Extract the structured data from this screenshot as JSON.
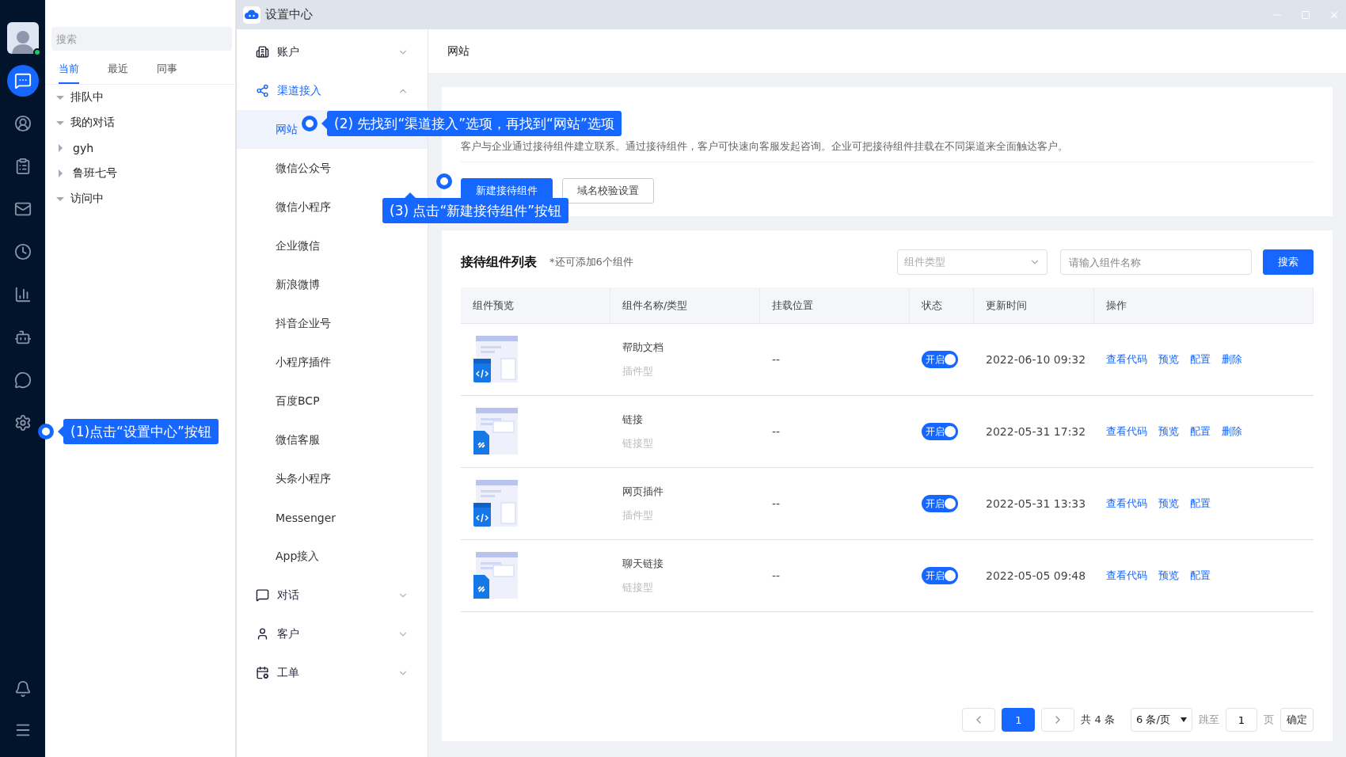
{
  "rail": {
    "items": [
      {
        "selected": true
      },
      {
        "selected": false
      },
      {
        "selected": false
      },
      {
        "selected": false
      },
      {
        "selected": false
      },
      {
        "selected": false
      },
      {
        "selected": false
      },
      {
        "selected": false
      },
      {
        "selected": false
      }
    ],
    "online": true
  },
  "conversations": {
    "search": {
      "placeholder": "搜索"
    },
    "tabs": [
      {
        "label": "当前",
        "selected": true
      },
      {
        "label": "最近",
        "selected": false
      },
      {
        "label": "同事",
        "selected": false
      }
    ],
    "tree": [
      {
        "label": "排队中",
        "expanded": true
      },
      {
        "label": "我的对话",
        "expanded": true
      },
      {
        "label": "gyh",
        "expanded": false
      },
      {
        "label": "鲁班七号",
        "expanded": false
      },
      {
        "label": "访问中",
        "expanded": true
      }
    ]
  },
  "window": {
    "title": "设置中心"
  },
  "nav": [
    {
      "label": "账户",
      "expanded": false,
      "selected": false
    },
    {
      "label": "渠道接入",
      "expanded": true,
      "selected": true,
      "children": [
        {
          "label": "网站",
          "selected": true
        },
        {
          "label": "微信公众号",
          "selected": false
        },
        {
          "label": "微信小程序",
          "selected": false
        },
        {
          "label": "企业微信",
          "selected": false
        },
        {
          "label": "新浪微博",
          "selected": false
        },
        {
          "label": "抖音企业号",
          "selected": false
        },
        {
          "label": "小程序插件",
          "selected": false
        },
        {
          "label": "百度BCP",
          "selected": false
        },
        {
          "label": "微信客服",
          "selected": false
        },
        {
          "label": "头条小程序",
          "selected": false
        },
        {
          "label": "Messenger",
          "selected": false
        },
        {
          "label": "App接入",
          "selected": false
        }
      ]
    },
    {
      "label": "对话",
      "expanded": false,
      "selected": false
    },
    {
      "label": "客户",
      "expanded": false,
      "selected": false
    },
    {
      "label": "工单",
      "expanded": false,
      "selected": false
    }
  ],
  "breadcrumb": "网站",
  "intro": {
    "description": "客户与企业通过接待组件建立联系。通过接待组件，客户可快速向客服发起咨询。企业可把接待组件挂载在不同渠道来全面触达客户。",
    "buttons": [
      {
        "label": "新建接待组件",
        "kind": "primary"
      },
      {
        "label": "域名校验设置",
        "kind": "default"
      }
    ]
  },
  "list": {
    "title": "接待组件列表",
    "note": "*还可添加6个组件",
    "type_select": {
      "placeholder": "组件类型"
    },
    "name_search": {
      "placeholder": "请输入组件名称"
    },
    "search_button": "搜索",
    "columns": [
      "组件预览",
      "组件名称/类型",
      "挂载位置",
      "状态",
      "更新时间",
      "操作"
    ],
    "rows": [
      {
        "kind": "plugin",
        "name": "帮助文档",
        "type": "插件型",
        "location": "--",
        "on": true,
        "status": "开启",
        "updated": "2022-06-10 09:32",
        "actions": [
          "查看代码",
          "预览",
          "配置",
          "删除"
        ]
      },
      {
        "kind": "link",
        "name": "链接",
        "type": "链接型",
        "location": "--",
        "on": true,
        "status": "开启",
        "updated": "2022-05-31 17:32",
        "actions": [
          "查看代码",
          "预览",
          "配置",
          "删除"
        ]
      },
      {
        "kind": "plugin",
        "name": "网页插件",
        "type": "插件型",
        "location": "--",
        "on": true,
        "status": "开启",
        "updated": "2022-05-31 13:33",
        "actions": [
          "查看代码",
          "预览",
          "配置"
        ]
      },
      {
        "kind": "link",
        "name": "聊天链接",
        "type": "链接型",
        "location": "--",
        "on": true,
        "status": "开启",
        "updated": "2022-05-05 09:48",
        "actions": [
          "查看代码",
          "预览",
          "配置"
        ]
      }
    ]
  },
  "pagination": {
    "pages": [
      {
        "label": "1",
        "selected": true
      }
    ],
    "total": "共 4 条",
    "page_size": "6 条/页",
    "jump_label": "跳至",
    "jump_value": "1",
    "page_unit": "页",
    "confirm": "确定"
  },
  "callouts": [
    {
      "text": "(1)点击“设置中心”按钮"
    },
    {
      "text": "(2) 先找到“渠道接入”选项，再找到“网站”选项"
    },
    {
      "text": "(3) 点击“新建接待组件”按钮"
    }
  ]
}
